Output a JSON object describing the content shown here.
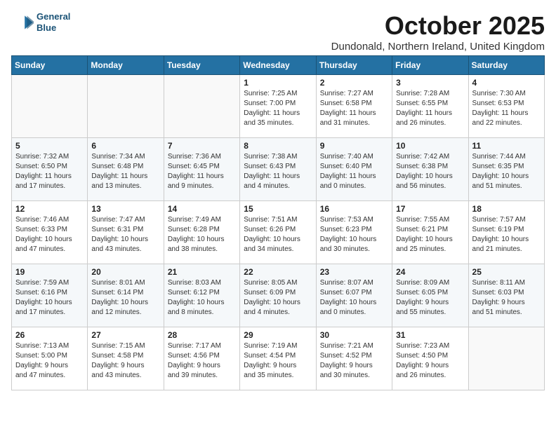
{
  "header": {
    "logo_line1": "General",
    "logo_line2": "Blue",
    "month": "October 2025",
    "location": "Dundonald, Northern Ireland, United Kingdom"
  },
  "weekdays": [
    "Sunday",
    "Monday",
    "Tuesday",
    "Wednesday",
    "Thursday",
    "Friday",
    "Saturday"
  ],
  "weeks": [
    [
      {
        "day": "",
        "info": ""
      },
      {
        "day": "",
        "info": ""
      },
      {
        "day": "",
        "info": ""
      },
      {
        "day": "1",
        "info": "Sunrise: 7:25 AM\nSunset: 7:00 PM\nDaylight: 11 hours\nand 35 minutes."
      },
      {
        "day": "2",
        "info": "Sunrise: 7:27 AM\nSunset: 6:58 PM\nDaylight: 11 hours\nand 31 minutes."
      },
      {
        "day": "3",
        "info": "Sunrise: 7:28 AM\nSunset: 6:55 PM\nDaylight: 11 hours\nand 26 minutes."
      },
      {
        "day": "4",
        "info": "Sunrise: 7:30 AM\nSunset: 6:53 PM\nDaylight: 11 hours\nand 22 minutes."
      }
    ],
    [
      {
        "day": "5",
        "info": "Sunrise: 7:32 AM\nSunset: 6:50 PM\nDaylight: 11 hours\nand 17 minutes."
      },
      {
        "day": "6",
        "info": "Sunrise: 7:34 AM\nSunset: 6:48 PM\nDaylight: 11 hours\nand 13 minutes."
      },
      {
        "day": "7",
        "info": "Sunrise: 7:36 AM\nSunset: 6:45 PM\nDaylight: 11 hours\nand 9 minutes."
      },
      {
        "day": "8",
        "info": "Sunrise: 7:38 AM\nSunset: 6:43 PM\nDaylight: 11 hours\nand 4 minutes."
      },
      {
        "day": "9",
        "info": "Sunrise: 7:40 AM\nSunset: 6:40 PM\nDaylight: 11 hours\nand 0 minutes."
      },
      {
        "day": "10",
        "info": "Sunrise: 7:42 AM\nSunset: 6:38 PM\nDaylight: 10 hours\nand 56 minutes."
      },
      {
        "day": "11",
        "info": "Sunrise: 7:44 AM\nSunset: 6:35 PM\nDaylight: 10 hours\nand 51 minutes."
      }
    ],
    [
      {
        "day": "12",
        "info": "Sunrise: 7:46 AM\nSunset: 6:33 PM\nDaylight: 10 hours\nand 47 minutes."
      },
      {
        "day": "13",
        "info": "Sunrise: 7:47 AM\nSunset: 6:31 PM\nDaylight: 10 hours\nand 43 minutes."
      },
      {
        "day": "14",
        "info": "Sunrise: 7:49 AM\nSunset: 6:28 PM\nDaylight: 10 hours\nand 38 minutes."
      },
      {
        "day": "15",
        "info": "Sunrise: 7:51 AM\nSunset: 6:26 PM\nDaylight: 10 hours\nand 34 minutes."
      },
      {
        "day": "16",
        "info": "Sunrise: 7:53 AM\nSunset: 6:23 PM\nDaylight: 10 hours\nand 30 minutes."
      },
      {
        "day": "17",
        "info": "Sunrise: 7:55 AM\nSunset: 6:21 PM\nDaylight: 10 hours\nand 25 minutes."
      },
      {
        "day": "18",
        "info": "Sunrise: 7:57 AM\nSunset: 6:19 PM\nDaylight: 10 hours\nand 21 minutes."
      }
    ],
    [
      {
        "day": "19",
        "info": "Sunrise: 7:59 AM\nSunset: 6:16 PM\nDaylight: 10 hours\nand 17 minutes."
      },
      {
        "day": "20",
        "info": "Sunrise: 8:01 AM\nSunset: 6:14 PM\nDaylight: 10 hours\nand 12 minutes."
      },
      {
        "day": "21",
        "info": "Sunrise: 8:03 AM\nSunset: 6:12 PM\nDaylight: 10 hours\nand 8 minutes."
      },
      {
        "day": "22",
        "info": "Sunrise: 8:05 AM\nSunset: 6:09 PM\nDaylight: 10 hours\nand 4 minutes."
      },
      {
        "day": "23",
        "info": "Sunrise: 8:07 AM\nSunset: 6:07 PM\nDaylight: 10 hours\nand 0 minutes."
      },
      {
        "day": "24",
        "info": "Sunrise: 8:09 AM\nSunset: 6:05 PM\nDaylight: 9 hours\nand 55 minutes."
      },
      {
        "day": "25",
        "info": "Sunrise: 8:11 AM\nSunset: 6:03 PM\nDaylight: 9 hours\nand 51 minutes."
      }
    ],
    [
      {
        "day": "26",
        "info": "Sunrise: 7:13 AM\nSunset: 5:00 PM\nDaylight: 9 hours\nand 47 minutes."
      },
      {
        "day": "27",
        "info": "Sunrise: 7:15 AM\nSunset: 4:58 PM\nDaylight: 9 hours\nand 43 minutes."
      },
      {
        "day": "28",
        "info": "Sunrise: 7:17 AM\nSunset: 4:56 PM\nDaylight: 9 hours\nand 39 minutes."
      },
      {
        "day": "29",
        "info": "Sunrise: 7:19 AM\nSunset: 4:54 PM\nDaylight: 9 hours\nand 35 minutes."
      },
      {
        "day": "30",
        "info": "Sunrise: 7:21 AM\nSunset: 4:52 PM\nDaylight: 9 hours\nand 30 minutes."
      },
      {
        "day": "31",
        "info": "Sunrise: 7:23 AM\nSunset: 4:50 PM\nDaylight: 9 hours\nand 26 minutes."
      },
      {
        "day": "",
        "info": ""
      }
    ]
  ]
}
